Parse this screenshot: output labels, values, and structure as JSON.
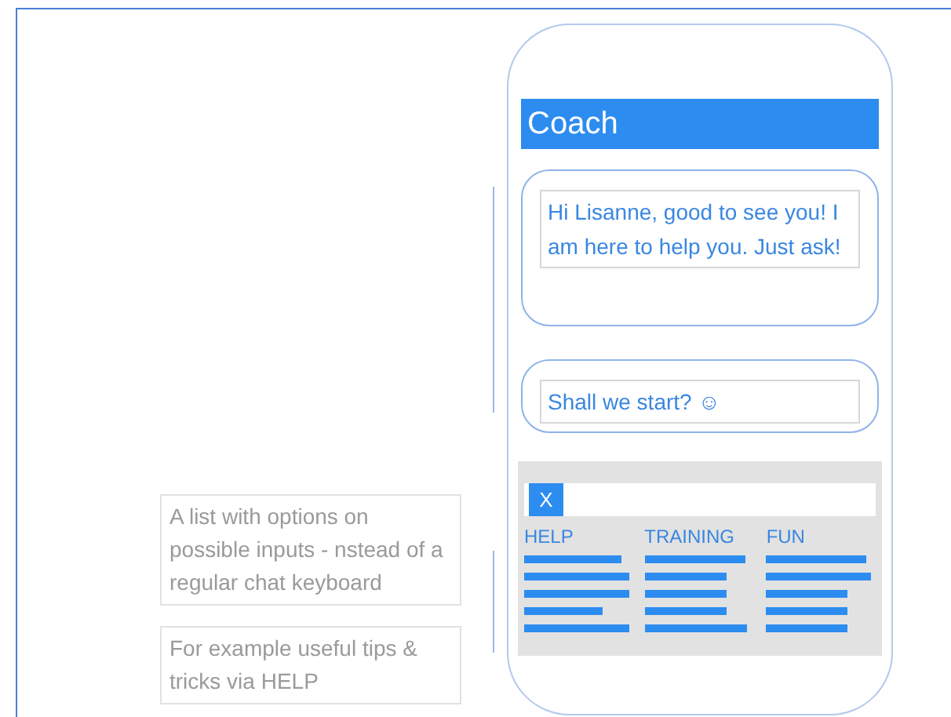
{
  "app": {
    "title": "Coach"
  },
  "messages": [
    "Hi Lisanne, good to see you! I am here to help you. Just ask!",
    "Shall we start? ☺"
  ],
  "options_panel": {
    "close_button": "X",
    "columns": [
      "HELP",
      "TRAINING",
      "FUN"
    ]
  },
  "notes": [
    "A list with options on possible inputs - nstead of a regular chat keyboard",
    "For example useful tips & tricks via HELP"
  ]
}
